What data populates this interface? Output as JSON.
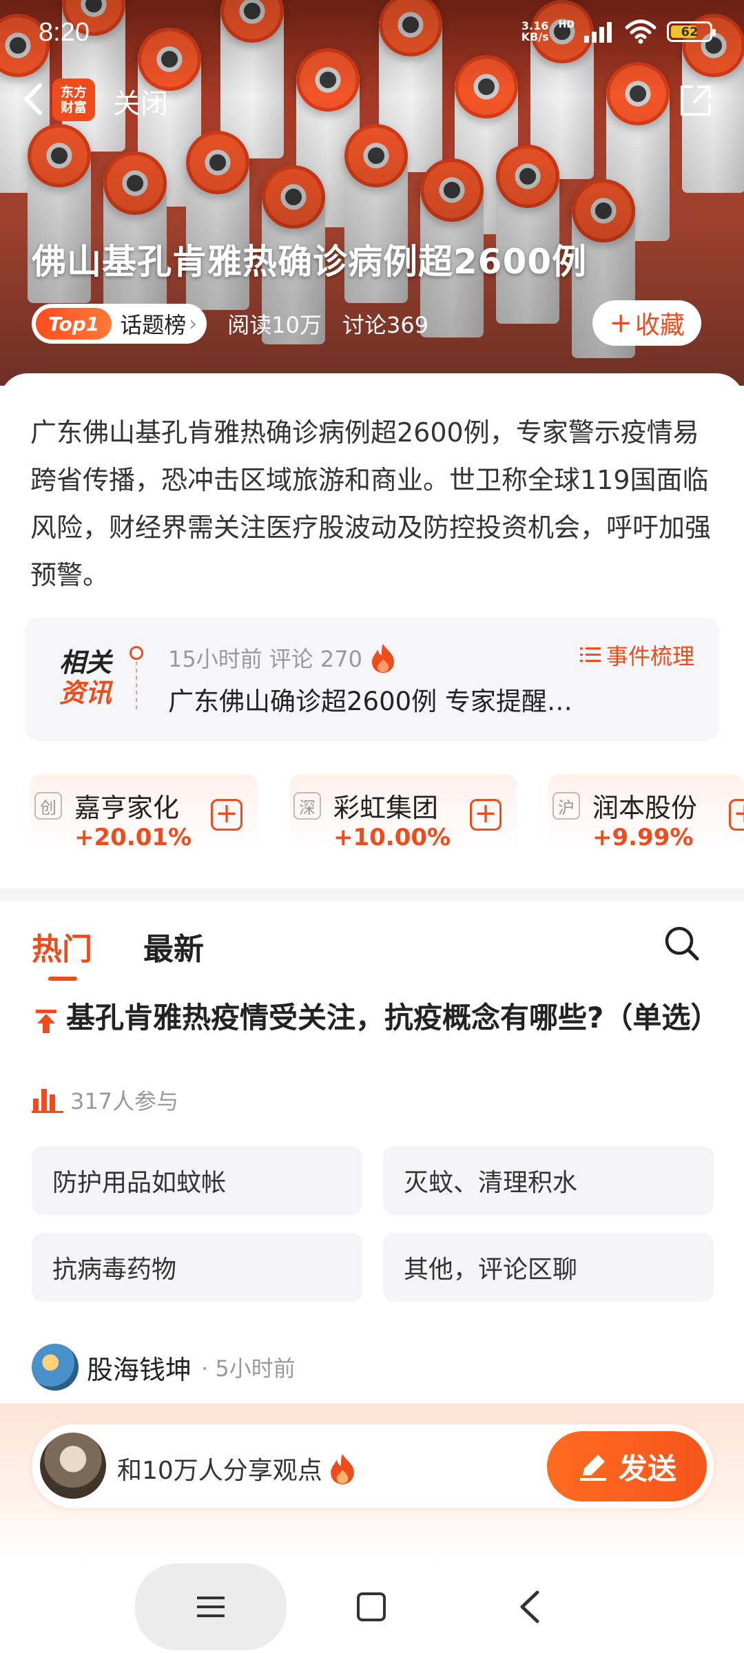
{
  "status": {
    "time": "8:20",
    "net_speed_value": "3.16",
    "net_speed_unit": "KB/s",
    "hd": "HD",
    "battery": "62"
  },
  "nav": {
    "logo_line1": "东方",
    "logo_line2": "财富",
    "close_label": "关闭"
  },
  "hero": {
    "title": "佛山基孔肯雅热确诊病例超2600例",
    "top_badge": "Top1",
    "topic_label": "话题榜",
    "topic_chevron": "›",
    "reads": "阅读10万",
    "discussions": "讨论369",
    "fav_plus": "+",
    "fav_label": "收藏"
  },
  "summary": {
    "text": "广东佛山基孔肯雅热确诊病例超2600例，专家警示疫情易跨省传播，恐冲击区域旅游和商业。世卫称全球119国面临风险，财经界需关注医疗股波动及防控投资机会，呼吁加强预警。"
  },
  "related": {
    "tag_line1": "相关",
    "tag_line2": "资讯",
    "time": "15小时前",
    "comments": "评论 270",
    "headline": "广东佛山确诊超2600例 专家提醒…",
    "sort_label": "事件梳理"
  },
  "stocks": [
    {
      "exchange": "创",
      "name": "嘉亨家化",
      "change": "+20.01%"
    },
    {
      "exchange": "深",
      "name": "彩虹集团",
      "change": "+10.00%"
    },
    {
      "exchange": "沪",
      "name": "润本股份",
      "change": "+9.99%"
    }
  ],
  "tabs": {
    "hot": "热门",
    "latest": "最新"
  },
  "poll": {
    "title": "基孔肯雅热疫情受关注，抗疫概念有哪些?（单选）",
    "participants": "317人参与",
    "options": [
      "防护用品如蚊帐",
      "灭蚊、清理积水",
      "抗病毒药物",
      "其他，评论区聊"
    ]
  },
  "author": {
    "name": "股海钱坤",
    "time": "· 5小时前"
  },
  "composer": {
    "placeholder": "和10万人分享观点",
    "send_label": "发送"
  },
  "colors": {
    "accent": "#f04b1c",
    "battery": "#f3c12b",
    "muted": "#999999"
  }
}
